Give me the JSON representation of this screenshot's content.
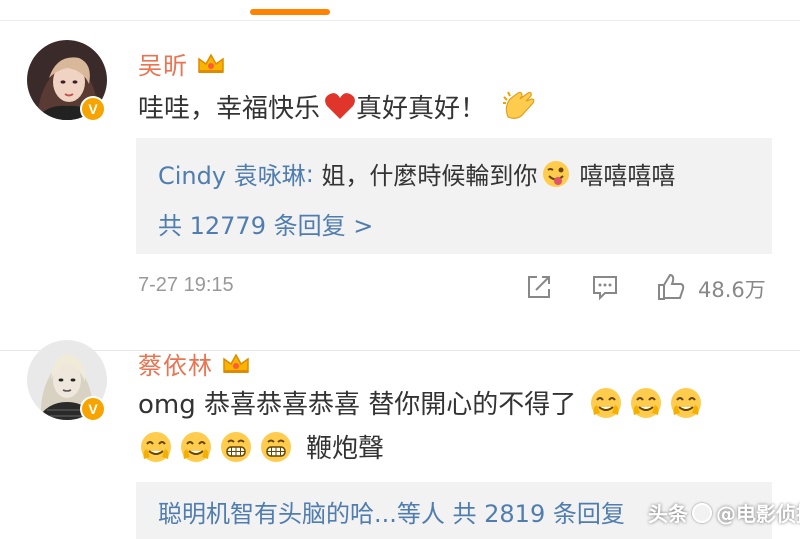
{
  "comments": [
    {
      "username": "吴昕",
      "text": "哇哇，幸福快乐",
      "text_after_heart": "真好真好！",
      "reply_user": "Cindy 袁咏琳",
      "reply_text": "姐，什麼時候輪到你",
      "reply_text_after": "嘻嘻嘻嘻",
      "reply_count": "共 12779 条回复 >",
      "timestamp": "7-27 19:15",
      "likes": "48.6万"
    },
    {
      "username": "蔡依林",
      "text_line1": "omg 恭喜恭喜恭喜  替你開心的不得了",
      "text_line2": "鞭炮聲",
      "reply_preview": "聪明机智有头脑的哈...等人  共 2819 条回复"
    }
  ],
  "verified_badge": "V",
  "watermark": {
    "platform": "头条",
    "account": "@电影侦探"
  },
  "colors": {
    "username": "#eb7350",
    "link": "#507daf",
    "accent": "#ff8200",
    "badge": "#f7a300"
  }
}
